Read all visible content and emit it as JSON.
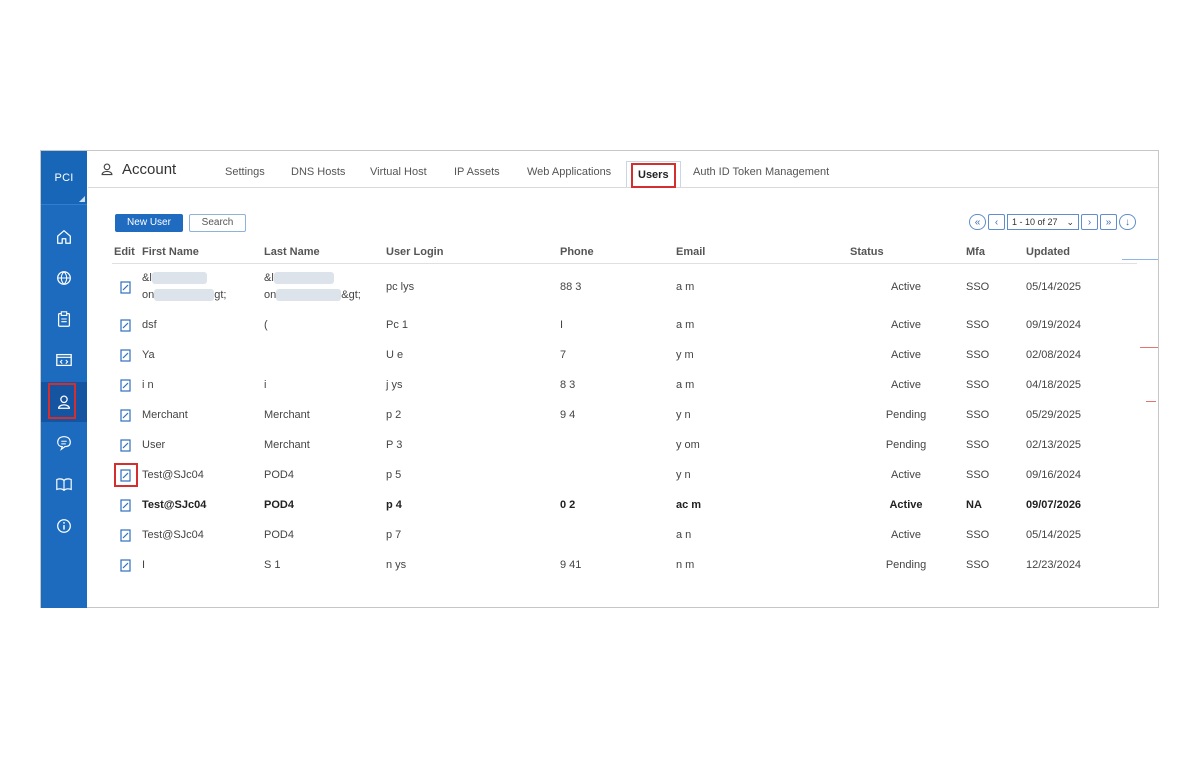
{
  "sidebar": {
    "brand": "PCI",
    "items": [
      {
        "name": "home-icon",
        "active": false
      },
      {
        "name": "globe-icon",
        "active": false
      },
      {
        "name": "clipboard-icon",
        "active": false
      },
      {
        "name": "code-window-icon",
        "active": false
      },
      {
        "name": "user-icon",
        "active": true
      },
      {
        "name": "chat-icon",
        "active": false
      },
      {
        "name": "book-icon",
        "active": false
      },
      {
        "name": "info-icon",
        "active": false
      }
    ]
  },
  "header": {
    "title": "Account",
    "tabs": [
      {
        "label": "Settings"
      },
      {
        "label": "DNS Hosts"
      },
      {
        "label": "Virtual Host"
      },
      {
        "label": "IP Assets"
      },
      {
        "label": "Web Applications"
      },
      {
        "label": "Users",
        "active": true
      },
      {
        "label": "Auth ID Token Management"
      }
    ]
  },
  "toolbar": {
    "new_user": "New User",
    "search": "Search"
  },
  "pager": {
    "range": "1 - 10 of 27"
  },
  "table": {
    "headers": [
      "Edit",
      "First Name",
      "Last Name",
      "User Login",
      "Phone",
      "Email",
      "Status",
      "Mfa",
      "Updated"
    ],
    "rows": [
      {
        "first": [
          "&l",
          "on",
          "gt;"
        ],
        "last": [
          "&l",
          "on",
          "&gt;"
        ],
        "login": "pc  lys",
        "phone": "88  3",
        "email": "a  m",
        "status": "Active",
        "mfa": "SSO",
        "updated": "05/14/2025"
      },
      {
        "first": "dsf",
        "last": "(",
        "login": "Pc  1",
        "phone": "I",
        "email": "a  m",
        "status": "Active",
        "mfa": "SSO",
        "updated": "09/19/2024"
      },
      {
        "first": "Ya",
        "last": "",
        "login": "U  e",
        "phone": "7",
        "email": "y  m",
        "status": "Active",
        "mfa": "SSO",
        "updated": "02/08/2024"
      },
      {
        "first": "i  n",
        "last": "i",
        "login": "j  ys",
        "phone": "8  3",
        "email": "a  m",
        "status": "Active",
        "mfa": "SSO",
        "updated": "04/18/2025"
      },
      {
        "first": "Merchant",
        "last": "Merchant",
        "login": "p  2",
        "phone": "9  4",
        "email": "y  n",
        "status": "Pending",
        "mfa": "SSO",
        "updated": "05/29/2025"
      },
      {
        "first": "User",
        "last": "Merchant",
        "login": "P  3",
        "phone": "",
        "email": "y  om",
        "status": "Pending",
        "mfa": "SSO",
        "updated": "02/13/2025"
      },
      {
        "first": "Test@SJc04",
        "last": "POD4",
        "login": "p  5",
        "phone": "",
        "email": "y  n",
        "status": "Active",
        "mfa": "SSO",
        "updated": "09/16/2024",
        "edit_highlight": true
      },
      {
        "first": "Test@SJc04",
        "last": "POD4",
        "login": "p  4",
        "phone": "0  2",
        "email": "ac  m",
        "status": "Active",
        "mfa": "NA",
        "updated": "09/07/2026",
        "bold": true
      },
      {
        "first": "Test@SJc04",
        "last": "POD4",
        "login": "p  7",
        "phone": "",
        "email": "a  n",
        "status": "Active",
        "mfa": "SSO",
        "updated": "05/14/2025"
      },
      {
        "first": "I",
        "last": "S  1",
        "login": "n  ys",
        "phone": "9  41",
        "email": "n  m",
        "status": "Pending",
        "mfa": "SSO",
        "updated": "12/23/2024"
      }
    ]
  }
}
